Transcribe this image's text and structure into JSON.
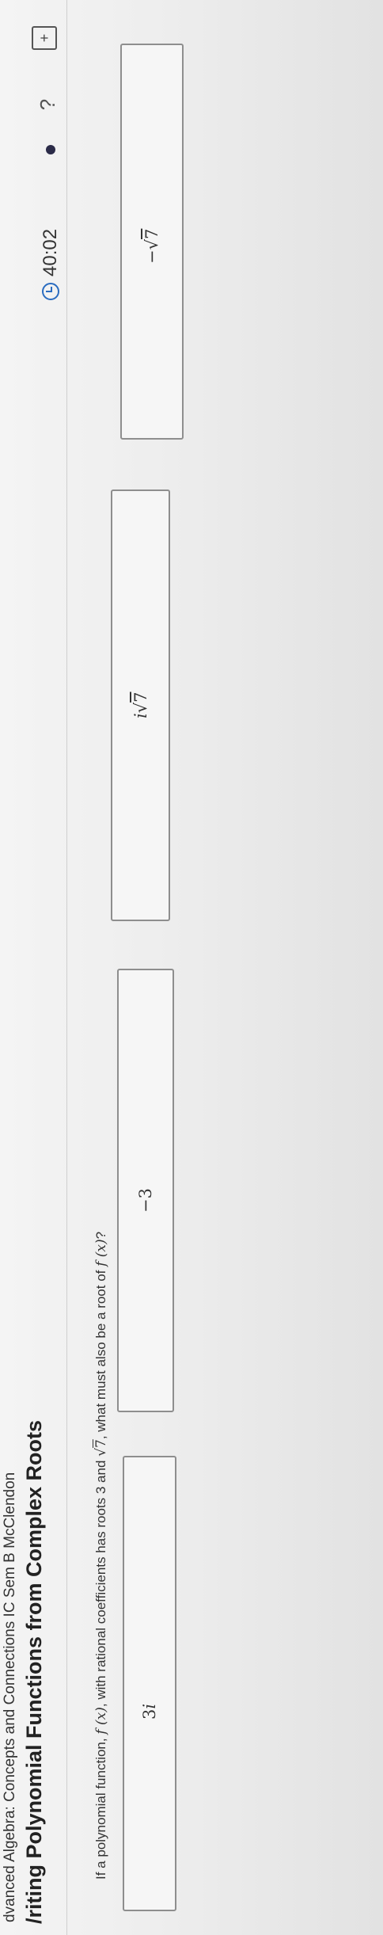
{
  "header": {
    "course": "dvanced Algebra: Concepts and Connections IC Sem B McClendon",
    "lesson": "/riting Polynomial Functions from Complex Roots"
  },
  "toolbar": {
    "timer_value": "40:02",
    "timer_icon": "clock-icon",
    "hint_icon": "lightbulb-icon",
    "calculator_icon": "calculator-icon",
    "calculator_glyph": "+"
  },
  "question": {
    "part1": "If a polynomial function, ",
    "f_of_x": "f (x)",
    "part2": ", with rational coefficients has roots 3 and ",
    "root_sqrt": "√",
    "root_radicand": "7",
    "part3": ", what must also be a root of ",
    "f_of_x_2": "f (x)",
    "part4": "?"
  },
  "choices": [
    {
      "id": "a",
      "text": "3",
      "suffix": "i"
    },
    {
      "id": "b",
      "text": "−3"
    },
    {
      "id": "c",
      "prefix": "i",
      "radical": "√",
      "radicand": "7"
    },
    {
      "id": "d",
      "prefix": "−",
      "radical": "√",
      "radicand": "7"
    }
  ],
  "colors": {
    "accent": "#2a6cc0",
    "border": "#8e8e8e",
    "background": "#ededed"
  }
}
